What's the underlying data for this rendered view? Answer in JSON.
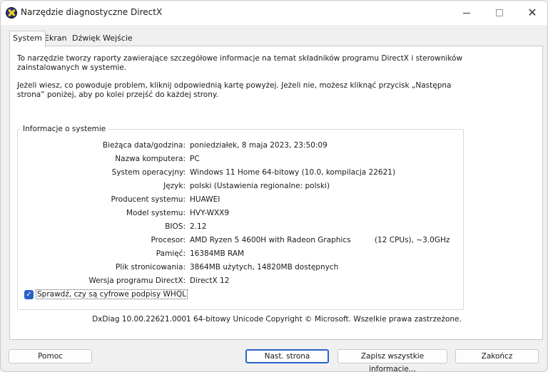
{
  "window": {
    "title": "Narzędzie diagnostyczne DirectX"
  },
  "tabs": [
    {
      "label": "System"
    },
    {
      "label": "Ekran"
    },
    {
      "label": "Dźwięk"
    },
    {
      "label": "Wejście"
    }
  ],
  "intro": {
    "paragraph1": "To narzędzie tworzy raporty zawierające szczegółowe informacje na temat składników programu DirectX i sterowników zainstalowanych w systemie.",
    "paragraph2": "Jeżeli wiesz, co powoduje problem, kliknij odpowiednią kartę powyżej. Jeżeli nie, możesz kliknąć przycisk „Następna strona” poniżej, aby po kolei przejść do każdej strony."
  },
  "system_info": {
    "title": "Informacje o systemie",
    "rows": [
      {
        "label": "Bieżąca data/godzina:",
        "value": "poniedziałek, 8 maja 2023, 23:50:09"
      },
      {
        "label": "Nazwa komputera:",
        "value": "PC"
      },
      {
        "label": "System operacyjny:",
        "value": "Windows 11 Home 64-bitowy (10.0, kompilacja 22621)"
      },
      {
        "label": "Język:",
        "value": "polski (Ustawienia regionalne: polski)"
      },
      {
        "label": "Producent systemu:",
        "value": "HUAWEI"
      },
      {
        "label": "Model systemu:",
        "value": "HVY-WXX9"
      },
      {
        "label": "BIOS:",
        "value": "2.12"
      },
      {
        "label": "Procesor:",
        "value": "AMD Ryzen 5 4600H with Radeon Graphics          (12 CPUs), ~3.0GHz"
      },
      {
        "label": "Pamięć:",
        "value": "16384MB RAM"
      },
      {
        "label": "Plik stronicowania:",
        "value": "3864MB użytych, 14820MB dostępnych"
      },
      {
        "label": "Wersja programu DirectX:",
        "value": "DirectX 12"
      }
    ],
    "whql_checkbox": {
      "label": "Sprawdź, czy są cyfrowe podpisy WHQL",
      "checked": true
    }
  },
  "footer": {
    "copyright": "DxDiag 10.00.22621.0001 64-bitowy Unicode  Copyright © Microsoft. Wszelkie prawa zastrzeżone."
  },
  "buttons": {
    "help": "Pomoc",
    "next": "Nast. strona",
    "save": "Zapisz wszystkie informacje...",
    "exit": "Zakończ"
  },
  "colors": {
    "accent": "#2860c8"
  }
}
